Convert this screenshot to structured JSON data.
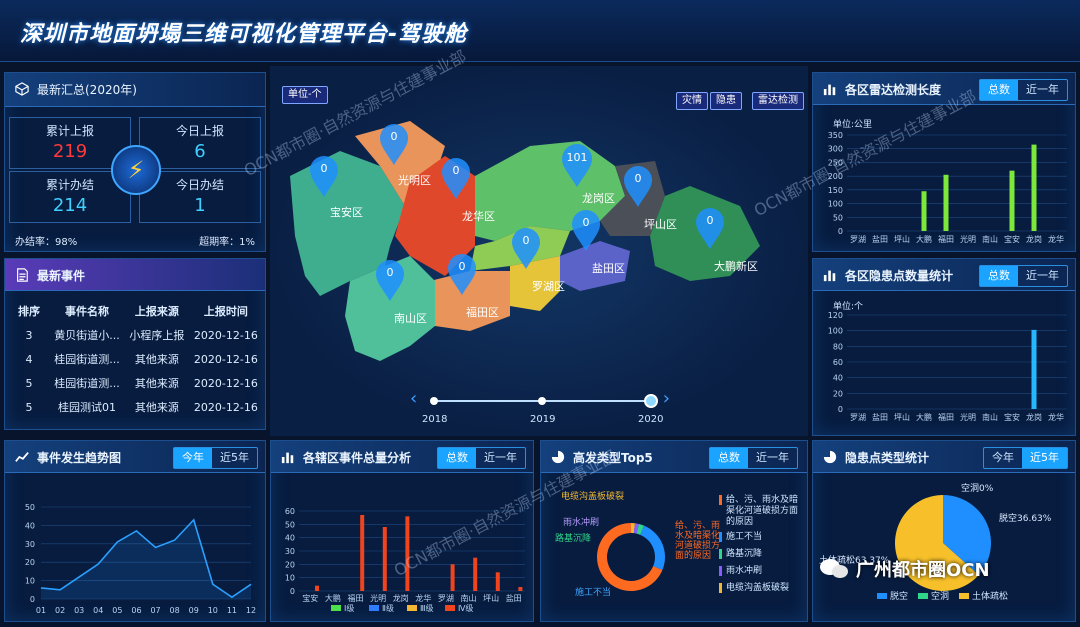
{
  "app": {
    "title": "深圳市地面坍塌三维可视化管理平台-驾驶舱"
  },
  "summary": {
    "title": "最新汇总(2020年)",
    "total_report_label": "累计上报",
    "total_report_value": "219",
    "today_report_label": "今日上报",
    "today_report_value": "6",
    "total_done_label": "累计办结",
    "total_done_value": "214",
    "today_done_label": "今日办结",
    "today_done_value": "1",
    "done_rate": "办结率：98%",
    "overdue_rate": "超期率：1%"
  },
  "events": {
    "title": "最新事件",
    "headers": [
      "排序",
      "事件名称",
      "上报来源",
      "上报时间"
    ],
    "rows": [
      [
        "3",
        "黄贝街道小...",
        "小程序上报",
        "2020-12-16"
      ],
      [
        "4",
        "桂园街道测...",
        "其他来源",
        "2020-12-16"
      ],
      [
        "5",
        "桂园街道测...",
        "其他来源",
        "2020-12-16"
      ],
      [
        "5",
        "桂园测试01",
        "其他来源",
        "2020-12-16"
      ]
    ]
  },
  "map": {
    "unit_button": "单位-个",
    "layer_buttons": [
      "灾情",
      "隐患",
      "雷达检测"
    ],
    "districts": [
      {
        "name": "宝安区",
        "count": "0",
        "color": "#3fae8e"
      },
      {
        "name": "光明区",
        "count": "0",
        "color": "#e8945a"
      },
      {
        "name": "龙华区",
        "count": "0",
        "color": "#e0482c"
      },
      {
        "name": "龙岗区",
        "count": "101",
        "color": "#5fc06a"
      },
      {
        "name": "坪山区",
        "count": "0",
        "color": "#4a4f58"
      },
      {
        "name": "大鹏新区",
        "count": "0",
        "color": "#2f8f56"
      },
      {
        "name": "盐田区",
        "count": "0",
        "color": "#5b63c8"
      },
      {
        "name": "罗湖区",
        "count": "0",
        "color": "#e6c43a"
      },
      {
        "name": "福田区",
        "count": "0",
        "color": "#e8945a"
      },
      {
        "name": "南山区",
        "count": "0",
        "color": "#4fc09a"
      }
    ],
    "timeline": [
      "2018",
      "2019",
      "2020"
    ]
  },
  "radar": {
    "title": "各区雷达检测长度",
    "tabs": [
      "总数",
      "近一年"
    ],
    "unit": "单位:公里",
    "chart_data": {
      "type": "bar",
      "categories": [
        "罗湖",
        "盐田",
        "坪山",
        "大鹏",
        "福田",
        "光明",
        "南山",
        "宝安",
        "龙岗",
        "龙华"
      ],
      "values": [
        0,
        0,
        0,
        145,
        205,
        0,
        0,
        220,
        315,
        0
      ],
      "ylim": [
        0,
        350
      ],
      "yticks": [
        "0",
        "50",
        "100",
        "150",
        "200",
        "250",
        "300",
        "350"
      ]
    }
  },
  "hazard": {
    "title": "各区隐患点数量统计",
    "tabs": [
      "总数",
      "近一年"
    ],
    "unit": "单位:个",
    "chart_data": {
      "type": "bar",
      "categories": [
        "罗湖",
        "盐田",
        "坪山",
        "大鹏",
        "福田",
        "光明",
        "南山",
        "宝安",
        "龙岗",
        "龙华"
      ],
      "values": [
        0,
        0,
        0,
        0,
        0,
        0,
        0,
        0,
        101,
        0
      ],
      "ylim": [
        0,
        120
      ],
      "yticks": [
        "0",
        "20",
        "40",
        "60",
        "80",
        "100",
        "120"
      ]
    }
  },
  "trend": {
    "title": "事件发生趋势图",
    "tabs": [
      "今年",
      "近5年"
    ],
    "chart_data": {
      "type": "line",
      "x": [
        "01",
        "02",
        "03",
        "04",
        "05",
        "06",
        "07",
        "08",
        "09",
        "10",
        "11",
        "12"
      ],
      "values": [
        6,
        5,
        12,
        19,
        31,
        37,
        28,
        32,
        43,
        8,
        1,
        8
      ],
      "ylim": [
        0,
        50
      ],
      "yticks": [
        "0",
        "10",
        "20",
        "30",
        "40",
        "50"
      ]
    }
  },
  "district_events": {
    "title": "各辖区事件总量分析",
    "tabs": [
      "总数",
      "近一年"
    ],
    "chart_data": {
      "type": "bar",
      "categories": [
        "宝安",
        "大鹏",
        "福田",
        "光明",
        "龙岗",
        "龙华",
        "罗湖",
        "南山",
        "坪山",
        "盐田"
      ],
      "series": [
        {
          "name": "Ⅰ级",
          "color": "#4ee04a",
          "values": [
            0,
            0,
            0,
            0,
            0,
            0,
            0,
            0,
            0,
            0
          ]
        },
        {
          "name": "Ⅱ级",
          "color": "#2f7cff",
          "values": [
            0,
            0,
            0,
            0,
            0,
            0,
            0,
            0,
            0,
            0
          ]
        },
        {
          "name": "Ⅲ级",
          "color": "#f3b833",
          "values": [
            0,
            0,
            0,
            0,
            0,
            0,
            0,
            0,
            0,
            0
          ]
        },
        {
          "name": "Ⅳ级",
          "color": "#f0441e",
          "values": [
            4,
            0,
            57,
            48,
            56,
            0,
            20,
            25,
            14,
            3
          ]
        }
      ],
      "ylim": [
        0,
        60
      ],
      "yticks": [
        "0",
        "10",
        "20",
        "30",
        "40",
        "50",
        "60"
      ]
    }
  },
  "top5": {
    "title": "高发类型Top5",
    "tabs": [
      "总数",
      "近一年"
    ],
    "chart_data": {
      "type": "pie",
      "labels": [
        "电缆沟盖板破裂",
        "雨水冲刷",
        "路基沉降",
        "施工不当",
        "给、污、雨水及暗渠化河道破损方面的原因"
      ],
      "values": [
        3,
        3,
        4,
        40,
        110
      ],
      "colors": [
        "#f3b833",
        "#8a5cff",
        "#2fd68a",
        "#1f8fff",
        "#ff6a21"
      ]
    },
    "legend": [
      "给、污、雨水及暗渠化河道破损方面的原因",
      "施工不当",
      "路基沉降",
      "雨水冲刷",
      "电缆沟盖板破裂"
    ],
    "callouts": [
      "电缆沟盖板破裂",
      "雨水冲刷",
      "路基沉降",
      "施工不当",
      "给、污、雨水及暗渠化河道破损方面的原因"
    ]
  },
  "hazard_types": {
    "title": "隐患点类型统计",
    "tabs": [
      "今年",
      "近5年"
    ],
    "chart_data": {
      "type": "pie",
      "labels": [
        "脱空",
        "空洞",
        "土体疏松"
      ],
      "values": [
        36.63,
        0,
        63.37
      ],
      "colors": [
        "#1f8fff",
        "#2fd68a",
        "#f7c02a"
      ]
    },
    "labels_text": [
      "脱空36.63%",
      "空洞0%",
      "土体疏松63.37%"
    ]
  },
  "watermark": {
    "lines": [
      "OCN都市圈·自然资源与住建事业部",
      "OCN都市圈 自然资源与住建事业部",
      "OCN都市圈·自然资源与住建事业部"
    ],
    "brand": "广州都市圈OCN"
  }
}
